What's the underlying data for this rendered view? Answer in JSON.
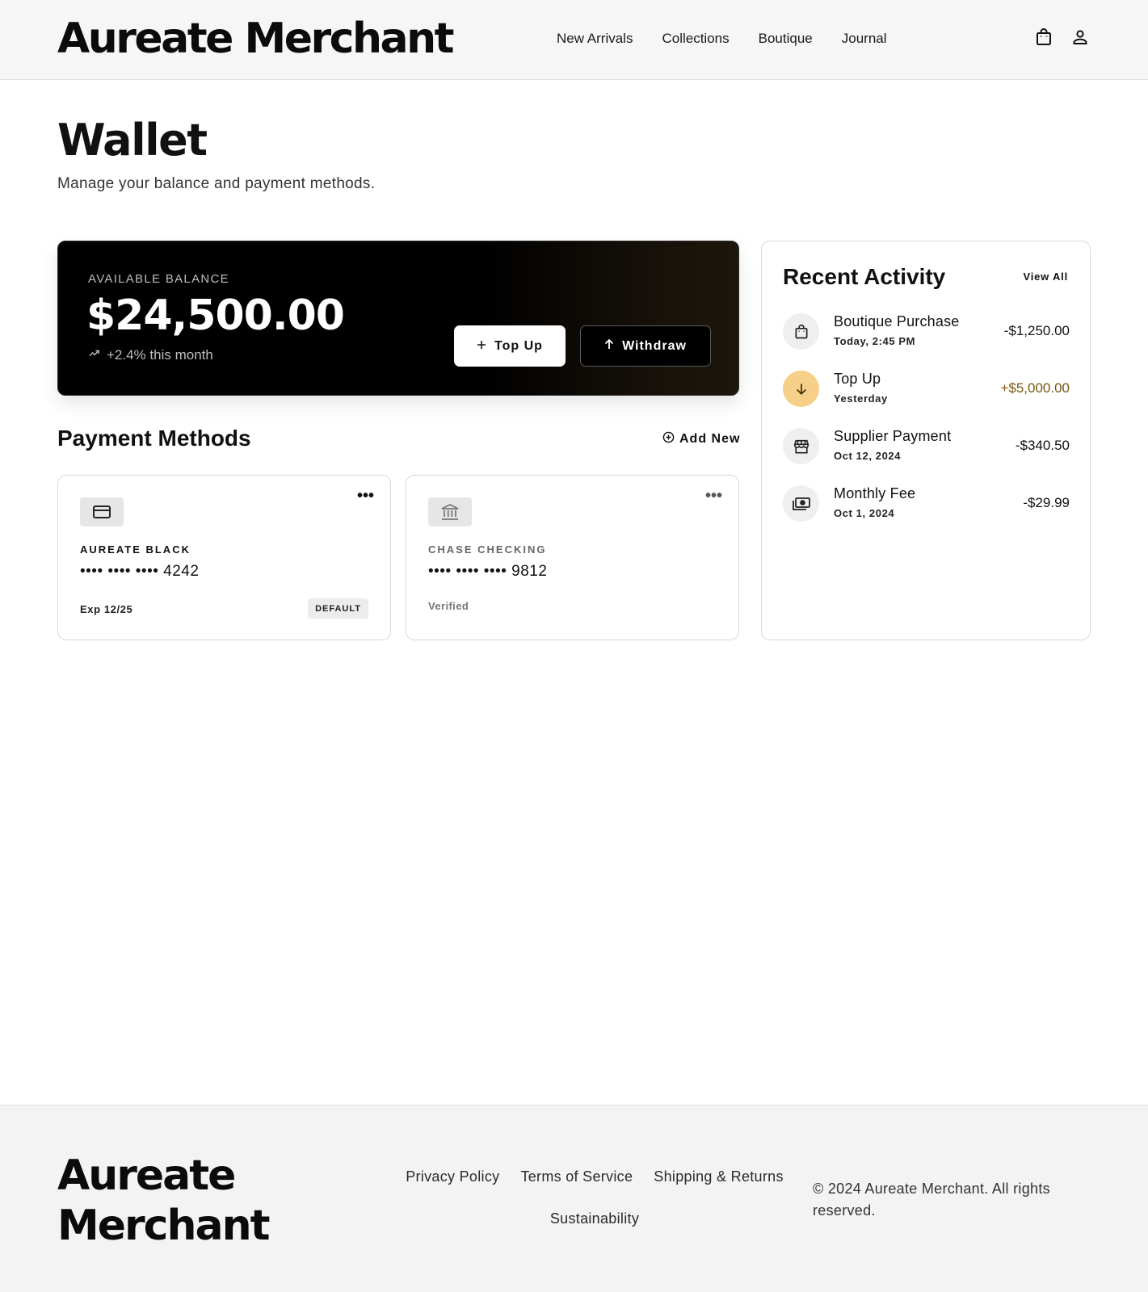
{
  "header": {
    "logo": "Aureate Merchant",
    "nav": [
      "New Arrivals",
      "Collections",
      "Boutique",
      "Journal"
    ],
    "icons": [
      "shopping-bag-icon",
      "user-icon"
    ]
  },
  "page": {
    "title": "Wallet",
    "subtitle": "Manage your balance and payment methods."
  },
  "balance": {
    "label": "AVAILABLE BALANCE",
    "amount": "$24,500.00",
    "trend": "+2.4% this month",
    "topup_label": "Top Up",
    "withdraw_label": "Withdraw"
  },
  "payment_methods": {
    "title": "Payment Methods",
    "add_label": "Add New",
    "cards": [
      {
        "name": "AUREATE BLACK",
        "number": "•••• •••• •••• 4242",
        "exp": "Exp 12/25",
        "badge": "DEFAULT",
        "icon": "credit-card-icon"
      },
      {
        "name": "CHASE CHECKING",
        "number": "•••• •••• •••• 9812",
        "status": "Verified",
        "icon": "bank-icon"
      }
    ]
  },
  "activity": {
    "title": "Recent Activity",
    "view_all": "View All",
    "items": [
      {
        "name": "Boutique Purchase",
        "date": "Today, 2:45 PM",
        "amount": "-$1,250.00",
        "icon": "shopping-bag-icon"
      },
      {
        "name": "Top Up",
        "date": "Yesterday",
        "amount": "+$5,000.00",
        "icon": "arrow-down-icon"
      },
      {
        "name": "Supplier Payment",
        "date": "Oct 12, 2024",
        "amount": "-$340.50",
        "icon": "storefront-icon"
      },
      {
        "name": "Monthly Fee",
        "date": "Oct 1, 2024",
        "amount": "-$29.99",
        "icon": "payments-icon"
      }
    ]
  },
  "footer": {
    "logo": "Aureate Merchant",
    "links": [
      "Privacy Policy",
      "Terms of Service",
      "Shipping & Returns",
      "Sustainability"
    ],
    "copyright": "© 2024 Aureate Merchant. All rights reserved."
  },
  "colors": {
    "accent_gold": "#f6d089",
    "positive_amount": "#7a5510",
    "balance_card": "#000000"
  }
}
